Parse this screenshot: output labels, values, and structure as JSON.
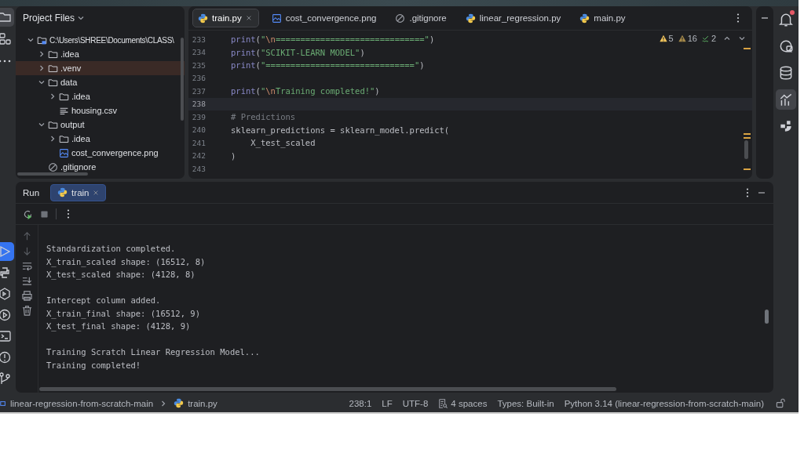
{
  "left_toolbar": [
    {
      "kind": "project",
      "selected": true
    },
    {
      "kind": "structure",
      "selected": false
    },
    {
      "kind": "more",
      "selected": false
    }
  ],
  "left_toolbar_bottom": [
    {
      "kind": "run",
      "selected": true
    },
    {
      "kind": "python-console",
      "selected": false
    },
    {
      "kind": "services",
      "selected": false
    },
    {
      "kind": "play-circle",
      "selected": false
    },
    {
      "kind": "terminal",
      "selected": false
    },
    {
      "kind": "problems",
      "selected": false
    },
    {
      "kind": "git",
      "selected": false
    }
  ],
  "project": {
    "title": "Project Files",
    "tree": [
      {
        "kind": "root",
        "label": "C:\\Users\\SHREE\\Documents\\CLASS\\",
        "expanded": true,
        "excluded": false,
        "children": [
          {
            "kind": "folder",
            "label": ".idea",
            "expanded": false,
            "excluded": false
          },
          {
            "kind": "folder",
            "label": ".venv",
            "expanded": false,
            "excluded": true
          },
          {
            "kind": "folder",
            "label": "data",
            "expanded": true,
            "excluded": false,
            "children": [
              {
                "kind": "folder",
                "label": ".idea",
                "expanded": false,
                "excluded": false
              },
              {
                "kind": "text-file",
                "label": "housing.csv",
                "excluded": false
              }
            ]
          },
          {
            "kind": "folder",
            "label": "output",
            "expanded": true,
            "excluded": false,
            "children": [
              {
                "kind": "folder",
                "label": ".idea",
                "expanded": false,
                "excluded": false
              },
              {
                "kind": "image-file",
                "label": "cost_convergence.png",
                "excluded": false
              }
            ]
          },
          {
            "kind": "ignore-file",
            "label": ".gitignore",
            "excluded": false
          }
        ]
      }
    ]
  },
  "editor": {
    "tabs": [
      {
        "kind": "python",
        "label": "train.py",
        "selected": true
      },
      {
        "kind": "image",
        "label": "cost_convergence.png",
        "selected": false
      },
      {
        "kind": "ignore",
        "label": ".gitignore",
        "selected": false
      },
      {
        "kind": "python",
        "label": "linear_regression.py",
        "selected": false
      },
      {
        "kind": "python",
        "label": "main.py",
        "selected": false
      }
    ],
    "inspections": [
      {
        "kind": "warning",
        "count": "5"
      },
      {
        "kind": "weak-warning",
        "count": "16"
      },
      {
        "kind": "typo",
        "count": "2"
      }
    ],
    "lines": [
      {
        "number": "233",
        "current": false,
        "code": [
          {
            "kind": "fn",
            "text": "print"
          },
          {
            "kind": "plain",
            "text": "("
          },
          {
            "kind": "str",
            "text": "\""
          },
          {
            "kind": "esc",
            "text": "\\n"
          },
          {
            "kind": "str",
            "text": "==============================\""
          },
          {
            "kind": "plain",
            "text": ")"
          }
        ]
      },
      {
        "number": "234",
        "current": false,
        "code": [
          {
            "kind": "fn",
            "text": "print"
          },
          {
            "kind": "plain",
            "text": "("
          },
          {
            "kind": "str",
            "text": "\"SCIKIT-LEARN MODEL\""
          },
          {
            "kind": "plain",
            "text": ")"
          }
        ]
      },
      {
        "number": "235",
        "current": false,
        "code": [
          {
            "kind": "fn",
            "text": "print"
          },
          {
            "kind": "plain",
            "text": "("
          },
          {
            "kind": "str",
            "text": "\"==============================\""
          },
          {
            "kind": "plain",
            "text": ")"
          }
        ]
      },
      {
        "number": "236",
        "current": false
      },
      {
        "number": "237",
        "current": false,
        "code": [
          {
            "kind": "fn",
            "text": "print"
          },
          {
            "kind": "plain",
            "text": "("
          },
          {
            "kind": "str",
            "text": "\""
          },
          {
            "kind": "esc",
            "text": "\\n"
          },
          {
            "kind": "str",
            "text": "Training completed!\""
          },
          {
            "kind": "plain",
            "text": ")"
          }
        ]
      },
      {
        "number": "238",
        "current": true
      },
      {
        "number": "239",
        "current": false,
        "code": [
          {
            "kind": "comment",
            "text": "# Predictions"
          }
        ]
      },
      {
        "number": "240",
        "current": false,
        "code": [
          {
            "kind": "plain",
            "text": "sklearn_predictions = sklearn_model.predict("
          }
        ]
      },
      {
        "number": "241",
        "current": false,
        "code": [
          {
            "kind": "plain",
            "text": "    X_test_scaled"
          }
        ]
      },
      {
        "number": "242",
        "current": false,
        "code": [
          {
            "kind": "plain",
            "text": ")"
          }
        ]
      },
      {
        "number": "243",
        "current": false
      }
    ]
  },
  "right_toolbar": [
    {
      "kind": "notifications",
      "selected": false,
      "badge": true
    },
    {
      "kind": "ai-chat",
      "selected": false,
      "badge": false
    },
    {
      "kind": "database",
      "selected": false,
      "badge": false
    },
    {
      "kind": "chart",
      "selected": true,
      "badge": false
    },
    {
      "kind": "plugin",
      "selected": false,
      "badge": false
    }
  ],
  "run": {
    "title": "Run",
    "tabs": [
      {
        "label": "train",
        "selected": true
      }
    ],
    "output": [
      [
        "Standardization completed.",
        "X_train_scaled shape: (16512, 8)",
        "X_test_scaled shape: (4128, 8)"
      ],
      [
        "Intercept column added.",
        "X_train_final shape: (16512, 9)",
        "X_test_final shape: (4128, 9)"
      ],
      [
        "Training Scratch Linear Regression Model...",
        "Training completed!"
      ]
    ]
  },
  "status_bar": {
    "breadcrumb": [
      "linear-regression-from-scratch-main",
      "train.py"
    ],
    "items": [
      {
        "kind": "text",
        "text": "238:1"
      },
      {
        "kind": "text",
        "text": "LF"
      },
      {
        "kind": "text",
        "text": "UTF-8"
      },
      {
        "kind": "indent",
        "text": "4 spaces"
      },
      {
        "kind": "text",
        "text": "Types: Built-in"
      },
      {
        "kind": "text",
        "text": "Python 3.14 (linear-regression-from-scratch-main)"
      }
    ]
  }
}
